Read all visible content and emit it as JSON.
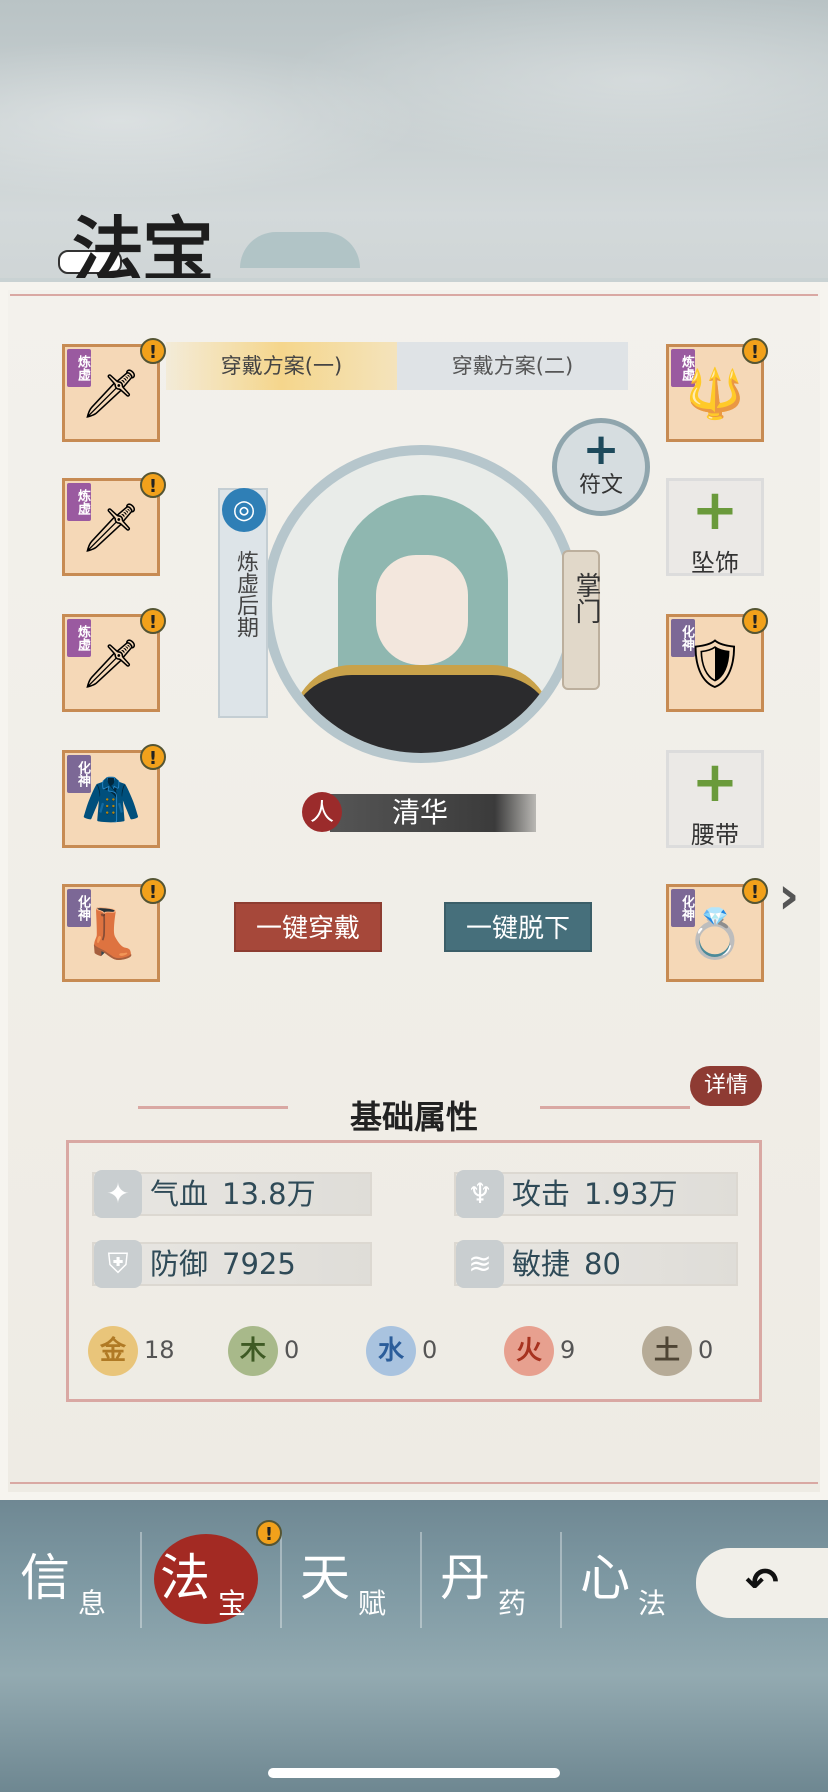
{
  "header": {
    "title": "法宝"
  },
  "plan_tabs": [
    {
      "label": "穿戴方案(一)",
      "active": true
    },
    {
      "label": "穿戴方案(二)",
      "active": false
    }
  ],
  "left_slots": [
    {
      "tag": "炼虚",
      "icon": "sword-icon",
      "alert": "!"
    },
    {
      "tag": "炼虚",
      "icon": "sword-icon",
      "alert": "!"
    },
    {
      "tag": "炼虚",
      "icon": "sword-icon",
      "alert": "!"
    },
    {
      "tag": "化神",
      "icon": "armor-icon",
      "alert": "!"
    },
    {
      "tag": "化神",
      "icon": "boots-icon",
      "alert": "!"
    }
  ],
  "right_slots": {
    "top": {
      "tag": "炼虚",
      "icon": "staff-icon",
      "alert": "!"
    },
    "pendant": {
      "plus": "+",
      "label": "坠饰"
    },
    "armor": {
      "tag": "化神",
      "icon": "bracer-icon",
      "alert": "!"
    },
    "belt": {
      "plus": "+",
      "label": "腰带"
    },
    "ring": {
      "tag": "化神",
      "icon": "ring-icon",
      "alert": "!"
    }
  },
  "rune": {
    "plus": "+",
    "label": "符文"
  },
  "character": {
    "realm": "炼虚后期",
    "sect_role": "掌门",
    "race": "人",
    "name": "清华"
  },
  "actions": {
    "equip_all": "一键穿戴",
    "unequip_all": "一键脱下",
    "details": "详情"
  },
  "stats": {
    "title": "基础属性",
    "hp_label": "气血",
    "hp_value": "13.8万",
    "atk_label": "攻击",
    "atk_value": "1.93万",
    "def_label": "防御",
    "def_value": "7925",
    "agi_label": "敏捷",
    "agi_value": "80",
    "elements": [
      {
        "name": "金",
        "value": "18",
        "color": "#e9c57a"
      },
      {
        "name": "木",
        "value": "0",
        "color": "#a8b98a"
      },
      {
        "name": "水",
        "value": "0",
        "color": "#a9c3df"
      },
      {
        "name": "火",
        "value": "9",
        "color": "#e7a08f"
      },
      {
        "name": "土",
        "value": "0",
        "color": "#b6ab97"
      }
    ]
  },
  "nav": {
    "items": [
      {
        "big": "信",
        "small": "息"
      },
      {
        "big": "法",
        "small": "宝"
      },
      {
        "big": "天",
        "small": "赋"
      },
      {
        "big": "丹",
        "small": "药"
      },
      {
        "big": "心",
        "small": "法"
      }
    ],
    "alert": "!",
    "back": "↶"
  }
}
